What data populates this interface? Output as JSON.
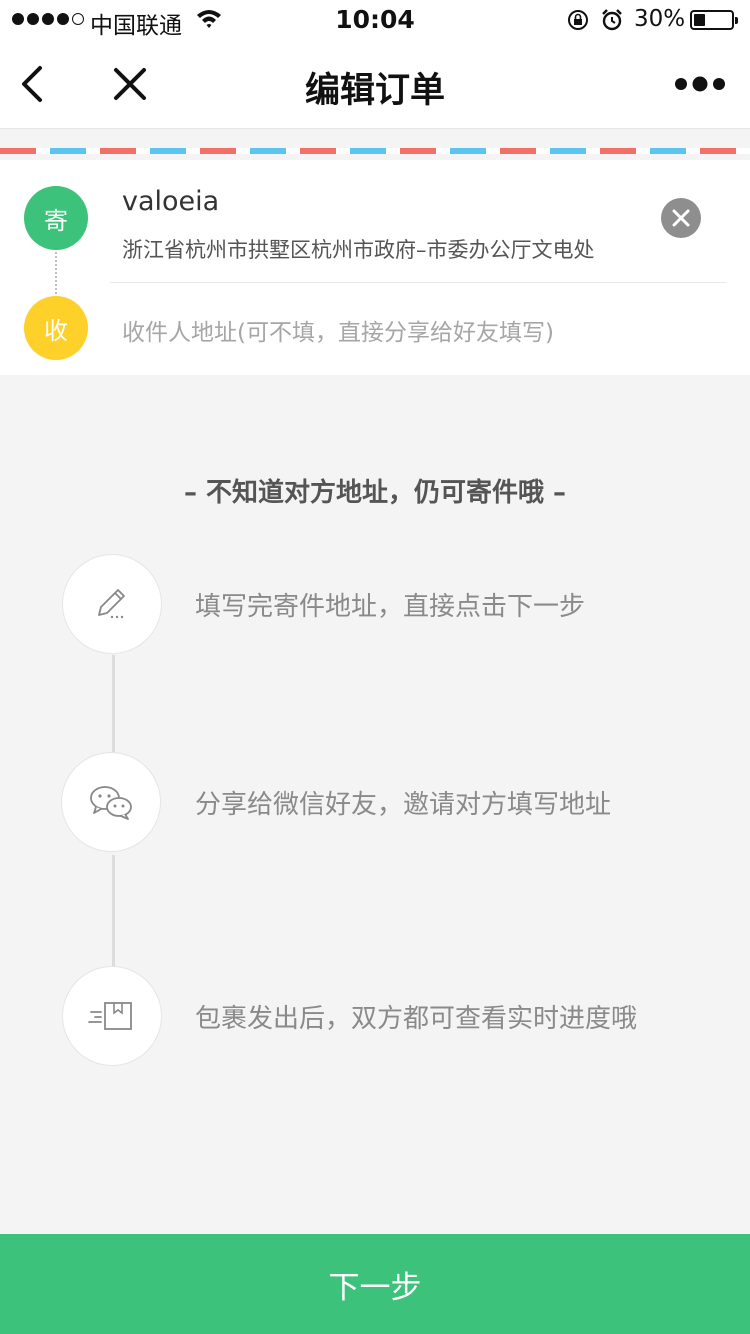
{
  "status_bar": {
    "carrier": "中国联通",
    "time": "10:04",
    "battery_percent": "30%",
    "battery_level": 0.3,
    "signal_bars": 4
  },
  "nav": {
    "title": "编辑订单",
    "back_icon": "chevron-left-icon",
    "close_icon": "close-icon",
    "more_icon": "more-dots-icon"
  },
  "address_card": {
    "sender_badge": "寄",
    "sender_name": "valoeia",
    "sender_address": "浙江省杭州市拱墅区杭州市政府–市委办公厅文电处",
    "receiver_badge": "收",
    "receiver_placeholder": "收件人地址(可不填，直接分享给好友填写)"
  },
  "hint": {
    "title": "– 不知道对方地址，仍可寄件哦 –",
    "steps": [
      {
        "icon": "pencil-icon",
        "text": "填写完寄件地址，直接点击下一步"
      },
      {
        "icon": "wechat-icon",
        "text": "分享给微信好友，邀请对方填写地址"
      },
      {
        "icon": "package-icon",
        "text": "包裹发出后，双方都可查看实时进度哦"
      }
    ]
  },
  "footer": {
    "next_button": "下一步"
  },
  "colors": {
    "accent_green": "#3cc27a",
    "badge_yellow": "#fdd02a",
    "stripe_red": "#f27066",
    "stripe_blue": "#5bc5ef"
  }
}
